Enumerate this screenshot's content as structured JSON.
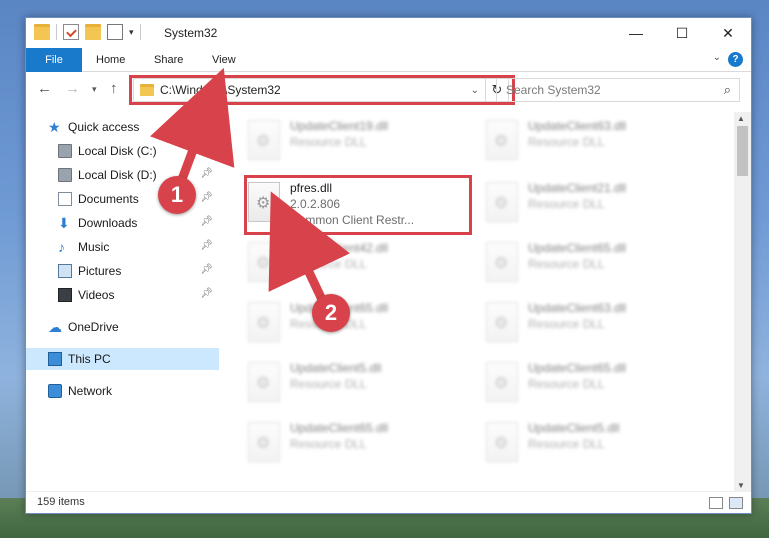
{
  "window": {
    "title": "System32",
    "controls": {
      "minimize": "—",
      "maximize": "☐",
      "close": "✕"
    }
  },
  "ribbon": {
    "tabs": [
      "File",
      "Home",
      "Share",
      "View"
    ],
    "help": "?"
  },
  "nav": {
    "address": "C:\\Windows\\System32",
    "search_placeholder": "Search System32"
  },
  "sidebar": {
    "items": [
      {
        "label": "Quick access",
        "icon": "star-icon",
        "pinned": false
      },
      {
        "label": "Local Disk (C:)",
        "icon": "disk-icon",
        "pinned": true
      },
      {
        "label": "Local Disk (D:)",
        "icon": "disk-icon",
        "pinned": true
      },
      {
        "label": "Documents",
        "icon": "documents-icon",
        "pinned": true
      },
      {
        "label": "Downloads",
        "icon": "downloads-icon",
        "pinned": true
      },
      {
        "label": "Music",
        "icon": "music-icon",
        "pinned": true
      },
      {
        "label": "Pictures",
        "icon": "pictures-icon",
        "pinned": true
      },
      {
        "label": "Videos",
        "icon": "videos-icon",
        "pinned": true
      },
      {
        "label": "OneDrive",
        "icon": "onedrive-icon",
        "pinned": false
      },
      {
        "label": "This PC",
        "icon": "this-pc-icon",
        "pinned": false,
        "selected": true
      },
      {
        "label": "Network",
        "icon": "network-icon",
        "pinned": false
      }
    ]
  },
  "files": {
    "col1": [
      {
        "name": "UpdateClient19.dll",
        "sub": "Resource DLL"
      },
      {
        "name": "pfres.dll",
        "version": "2.0.2.806",
        "sub": "Common Client Restr...",
        "highlight": true
      },
      {
        "name": "UpdateClient42.dll",
        "sub": "Resource DLL"
      },
      {
        "name": "UpdateClient65.dll",
        "sub": "Resource DLL"
      },
      {
        "name": "UpdateClient5.dll",
        "sub": "Resource DLL"
      },
      {
        "name": "UpdateClient65.dll",
        "sub": "Resource DLL"
      }
    ],
    "col2": [
      {
        "name": "UpdateClient63.dll",
        "sub": "Resource DLL"
      },
      {
        "name": "UpdateClient21.dll",
        "sub": "Resource DLL"
      },
      {
        "name": "UpdateClient65.dll",
        "sub": "Resource DLL"
      },
      {
        "name": "UpdateClient63.dll",
        "sub": "Resource DLL"
      },
      {
        "name": "UpdateClient65.dll",
        "sub": "Resource DLL"
      },
      {
        "name": "UpdateClient5.dll",
        "sub": "Resource DLL"
      }
    ]
  },
  "status": {
    "items": "159 items"
  },
  "callouts": [
    "1",
    "2"
  ],
  "colors": {
    "accent": "#1979ca",
    "callout": "#d8424a",
    "selected": "#cce8ff"
  }
}
